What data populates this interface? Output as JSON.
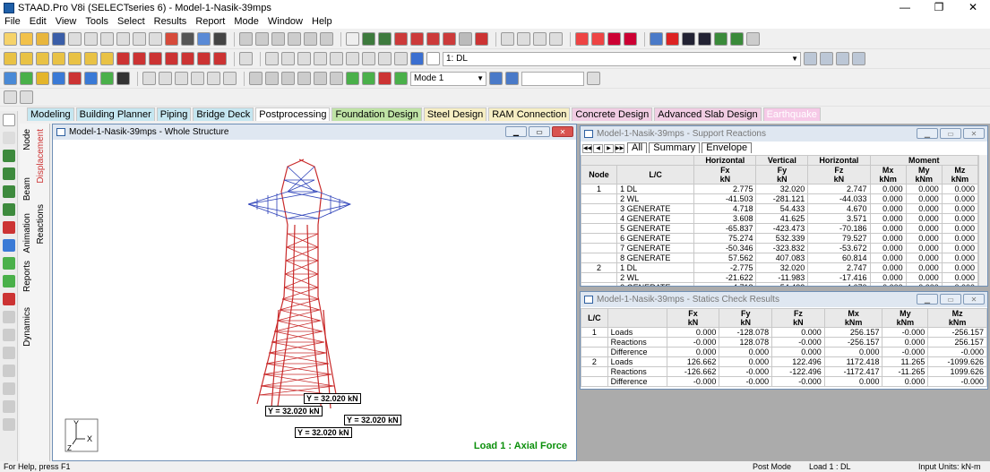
{
  "app": {
    "title": "STAAD.Pro V8i (SELECTseries 6) - Model-1-Nasik-39mps"
  },
  "menu": [
    "File",
    "Edit",
    "View",
    "Tools",
    "Select",
    "Results",
    "Report",
    "Mode",
    "Window",
    "Help"
  ],
  "toolbar": {
    "load_combo": "1: DL",
    "mode_combo": "Mode 1"
  },
  "page_tabs": [
    "Modeling",
    "Building Planner",
    "Piping",
    "Bridge Deck",
    "Postprocessing",
    "Foundation Design",
    "Steel Design",
    "RAM Connection",
    "Concrete Design",
    "Advanced Slab Design",
    "Earthquake"
  ],
  "tab_colors": [
    "#c5e6f0",
    "#c5e6f0",
    "#c5e6f0",
    "#c5e6f0",
    "#ffffff",
    "#bfe3a6",
    "#f6eec3",
    "#f6eec3",
    "#f1cde3",
    "#f1cde3",
    "#f6c9e7"
  ],
  "side_tabs": [
    "Node",
    "Displacement",
    "Beam",
    "Reactions",
    "Animation",
    "Reports",
    "Dynamics"
  ],
  "structure_window": {
    "title": "Model-1-Nasik-39mps - Whole Structure",
    "labels": [
      "Y = 32.020 kN",
      "Y = 32.020 kN",
      "Y = 32.020 kN",
      "Y = 32.020 kN"
    ],
    "load_caption": "Load 1 : Axial Force",
    "axis_y": "Y",
    "axis_z": "Z",
    "axis_x": "X"
  },
  "support_window": {
    "title": "Model-1-Nasik-39mps - Support Reactions",
    "tabs": [
      "All",
      "Summary",
      "Envelope"
    ],
    "group_headers": [
      "Horizontal",
      "Vertical",
      "Horizontal",
      "Moment"
    ],
    "headers": [
      "Node",
      "L/C",
      "Fx\nkN",
      "Fy\nkN",
      "Fz\nkN",
      "Mx\nkNm",
      "My\nkNm",
      "Mz\nkNm"
    ],
    "rows": [
      [
        "1",
        "1 DL",
        "2.775",
        "32.020",
        "2.747",
        "0.000",
        "0.000",
        "0.000"
      ],
      [
        "",
        "2 WL",
        "-41.503",
        "-281.121",
        "-44.033",
        "0.000",
        "0.000",
        "0.000"
      ],
      [
        "",
        "3 GENERATE",
        "4.718",
        "54.433",
        "4.670",
        "0.000",
        "0.000",
        "0.000"
      ],
      [
        "",
        "4 GENERATE",
        "3.608",
        "41.625",
        "3.571",
        "0.000",
        "0.000",
        "0.000"
      ],
      [
        "",
        "5 GENERATE",
        "-65.837",
        "-423.473",
        "-70.186",
        "0.000",
        "0.000",
        "0.000"
      ],
      [
        "",
        "6 GENERATE",
        "75.274",
        "532.339",
        "79.527",
        "0.000",
        "0.000",
        "0.000"
      ],
      [
        "",
        "7 GENERATE",
        "-50.346",
        "-323.832",
        "-53.672",
        "0.000",
        "0.000",
        "0.000"
      ],
      [
        "",
        "8 GENERATE",
        "57.562",
        "407.083",
        "60.814",
        "0.000",
        "0.000",
        "0.000"
      ],
      [
        "2",
        "1 DL",
        "-2.775",
        "32.020",
        "2.747",
        "0.000",
        "0.000",
        "0.000"
      ],
      [
        "",
        "2 WL",
        "-21.622",
        "-11.983",
        "-17.416",
        "0.000",
        "0.000",
        "0.000"
      ],
      [
        "",
        "3 GENERATE",
        "4.718",
        "54.433",
        "4.670",
        "0.000",
        "0.000",
        "0.000"
      ]
    ]
  },
  "statics_window": {
    "title": "Model-1-Nasik-39mps - Statics Check Results",
    "headers": [
      "L/C",
      "",
      "Fx\nkN",
      "Fy\nkN",
      "Fz\nkN",
      "Mx\nkNm",
      "My\nkNm",
      "Mz\nkNm"
    ],
    "rows": [
      [
        "1",
        "Loads",
        "0.000",
        "-128.078",
        "0.000",
        "256.157",
        "-0.000",
        "-256.157"
      ],
      [
        "",
        "Reactions",
        "-0.000",
        "128.078",
        "-0.000",
        "-256.157",
        "0.000",
        "256.157"
      ],
      [
        "",
        "Difference",
        "0.000",
        "0.000",
        "0.000",
        "0.000",
        "-0.000",
        "-0.000"
      ],
      [
        "2",
        "Loads",
        "126.662",
        "0.000",
        "122.496",
        "1172.418",
        "11.265",
        "-1099.626"
      ],
      [
        "",
        "Reactions",
        "-126.662",
        "-0.000",
        "-122.496",
        "-1172.417",
        "-11.265",
        "1099.626"
      ],
      [
        "",
        "Difference",
        "-0.000",
        "-0.000",
        "-0.000",
        "0.000",
        "0.000",
        "-0.000"
      ]
    ]
  },
  "status": {
    "help": "For Help, press F1",
    "mode": "Post Mode",
    "load": "Load 1 : DL",
    "units": "Input Units:  kN-m"
  }
}
